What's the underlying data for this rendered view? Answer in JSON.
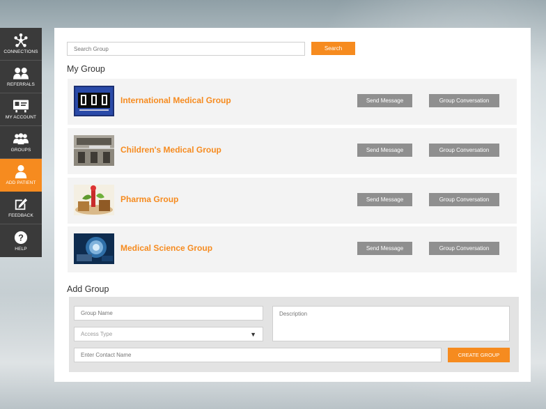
{
  "sidebar": {
    "items": [
      {
        "label": "CONNECTIONS",
        "icon": "connections-icon"
      },
      {
        "label": "REFERRALS",
        "icon": "referrals-icon"
      },
      {
        "label": "MY ACCOUNT",
        "icon": "account-card-icon"
      },
      {
        "label": "GROUPS",
        "icon": "groups-icon"
      },
      {
        "label": "ADD PATIENT",
        "icon": "add-patient-icon",
        "active": true
      },
      {
        "label": "FEEDBACK",
        "icon": "feedback-pencil-icon"
      },
      {
        "label": "HELP",
        "icon": "help-icon"
      }
    ]
  },
  "search": {
    "placeholder": "Search Group",
    "button_label": "Search"
  },
  "my_group": {
    "title": "My Group",
    "groups": [
      {
        "name": "International Medical Group",
        "send_label": "Send Message",
        "conversation_label": "Group Conversation"
      },
      {
        "name": "Children's Medical Group",
        "send_label": "Send Message",
        "conversation_label": "Group Conversation"
      },
      {
        "name": "Pharma Group",
        "send_label": "Send Message",
        "conversation_label": "Group Conversation"
      },
      {
        "name": "Medical Science Group",
        "send_label": "Send Message",
        "conversation_label": "Group Conversation"
      }
    ]
  },
  "add_group": {
    "title": "Add Group",
    "group_name_placeholder": "Group Name",
    "access_type_placeholder": "Access Type",
    "description_placeholder": "Description",
    "contact_placeholder": "Enter Contact Name",
    "create_label": "CREATE GROUP"
  },
  "colors": {
    "accent": "#f68b1f",
    "sidebar": "#3a3a3a",
    "button_gray": "#8f8f8f"
  }
}
